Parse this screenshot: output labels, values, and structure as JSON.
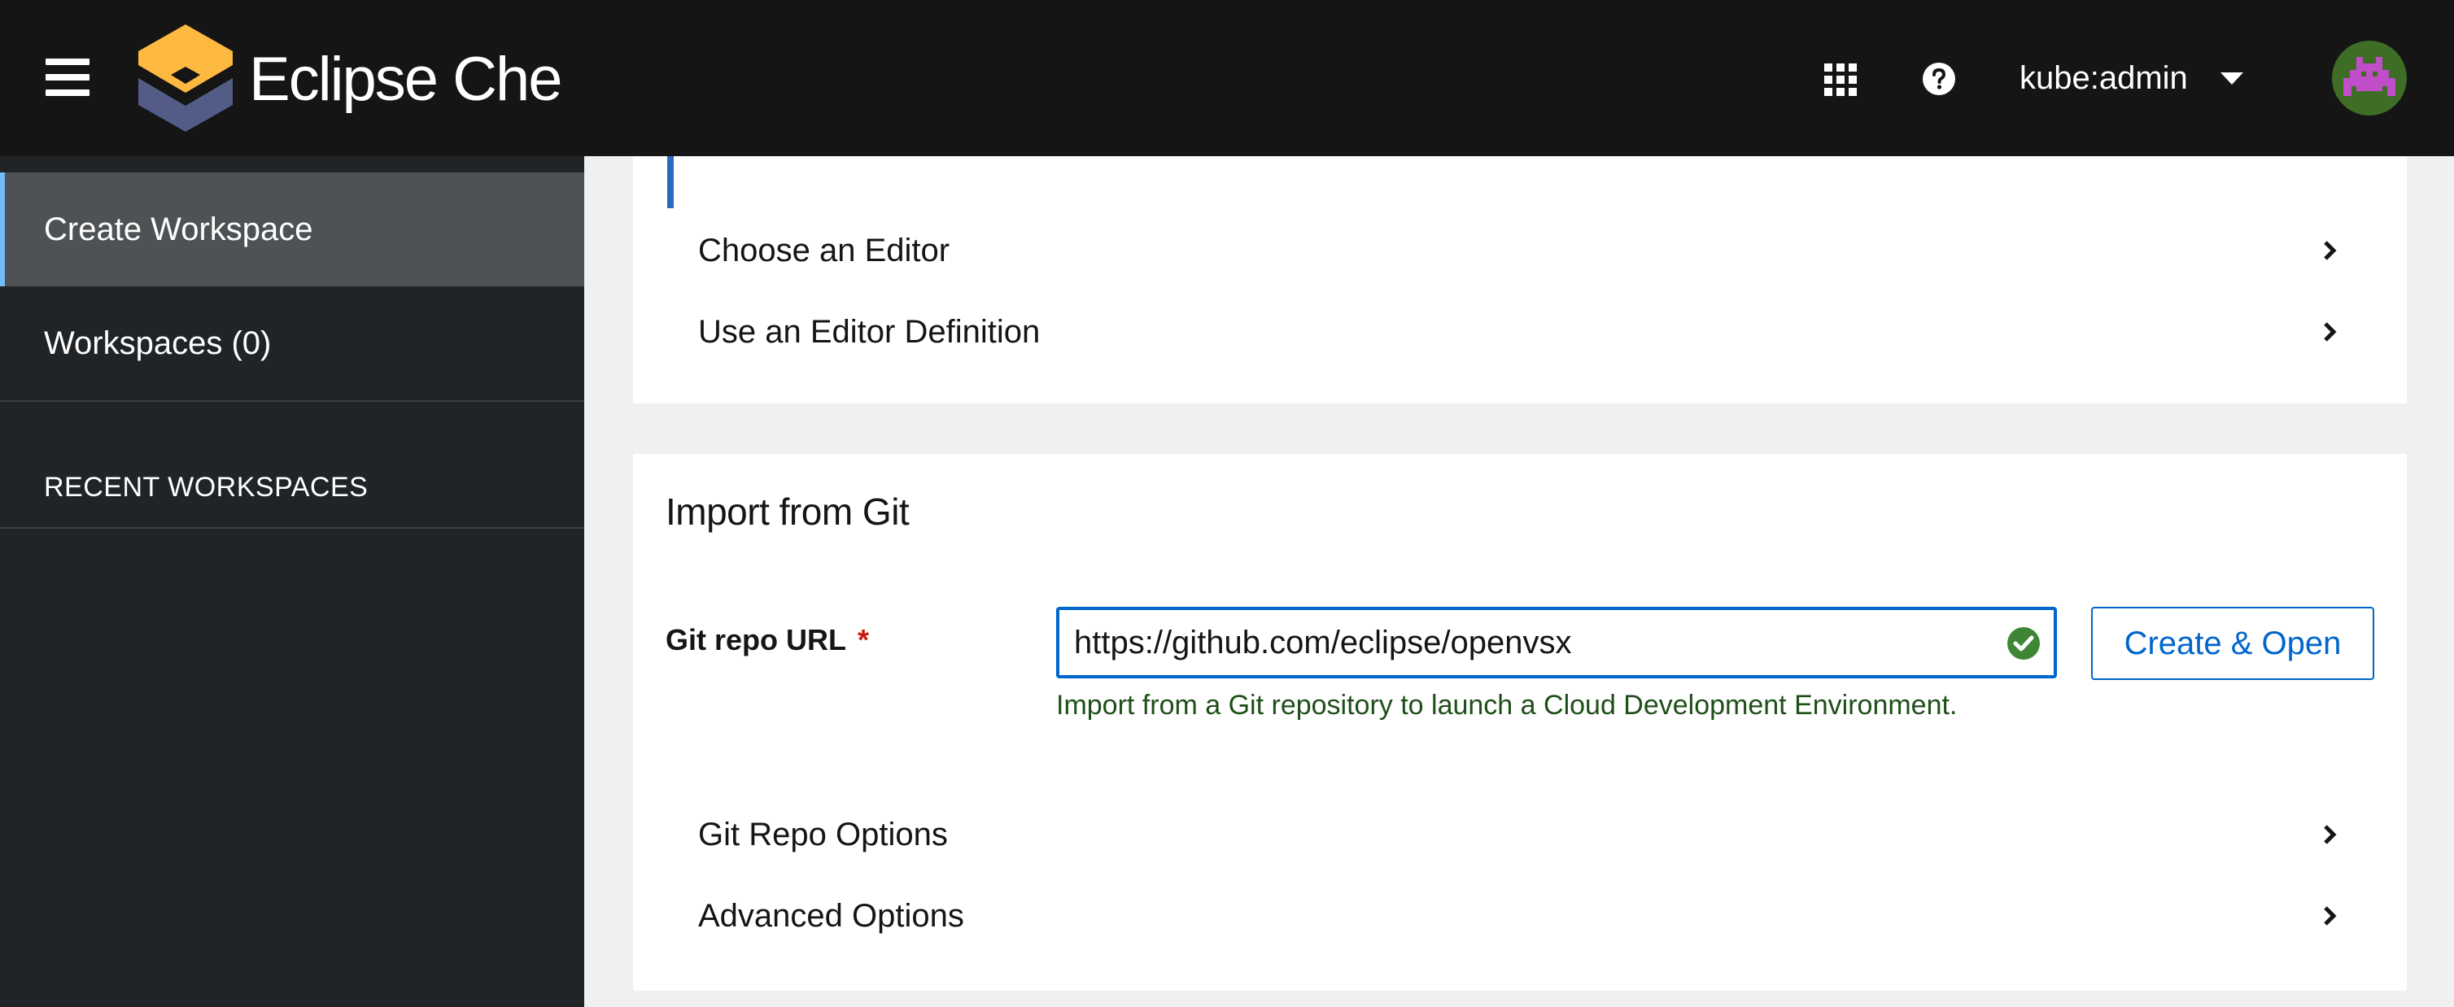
{
  "header": {
    "brand": "Eclipse Che",
    "user": "kube:admin",
    "icons": {
      "menu": "hamburger-menu-icon",
      "apps": "app-launcher-icon",
      "help": "help-icon",
      "user_caret": "caret-down-icon",
      "avatar": "avatar"
    },
    "colors": {
      "background": "#151515",
      "logo_top": "#fdb940",
      "logo_bottom": "#525c86"
    }
  },
  "sidebar": {
    "items": [
      {
        "label": "Create Workspace",
        "active": true
      },
      {
        "label": "Workspaces (0)",
        "active": false
      }
    ],
    "section_title": "RECENT WORKSPACES"
  },
  "editor_card": {
    "rows": [
      {
        "label": "Choose an Editor"
      },
      {
        "label": "Use an Editor Definition"
      }
    ]
  },
  "import_card": {
    "title": "Import from Git",
    "field_label": "Git repo URL",
    "required_mark": "*",
    "url_value": "https://github.com/eclipse/openvsx",
    "helper_text": "Import from a Git repository to launch a Cloud Development Environment.",
    "button_label": "Create & Open",
    "rows": [
      {
        "label": "Git Repo Options"
      },
      {
        "label": "Advanced Options"
      }
    ],
    "colors": {
      "accent": "#0066cc",
      "success": "#3e8635"
    }
  }
}
